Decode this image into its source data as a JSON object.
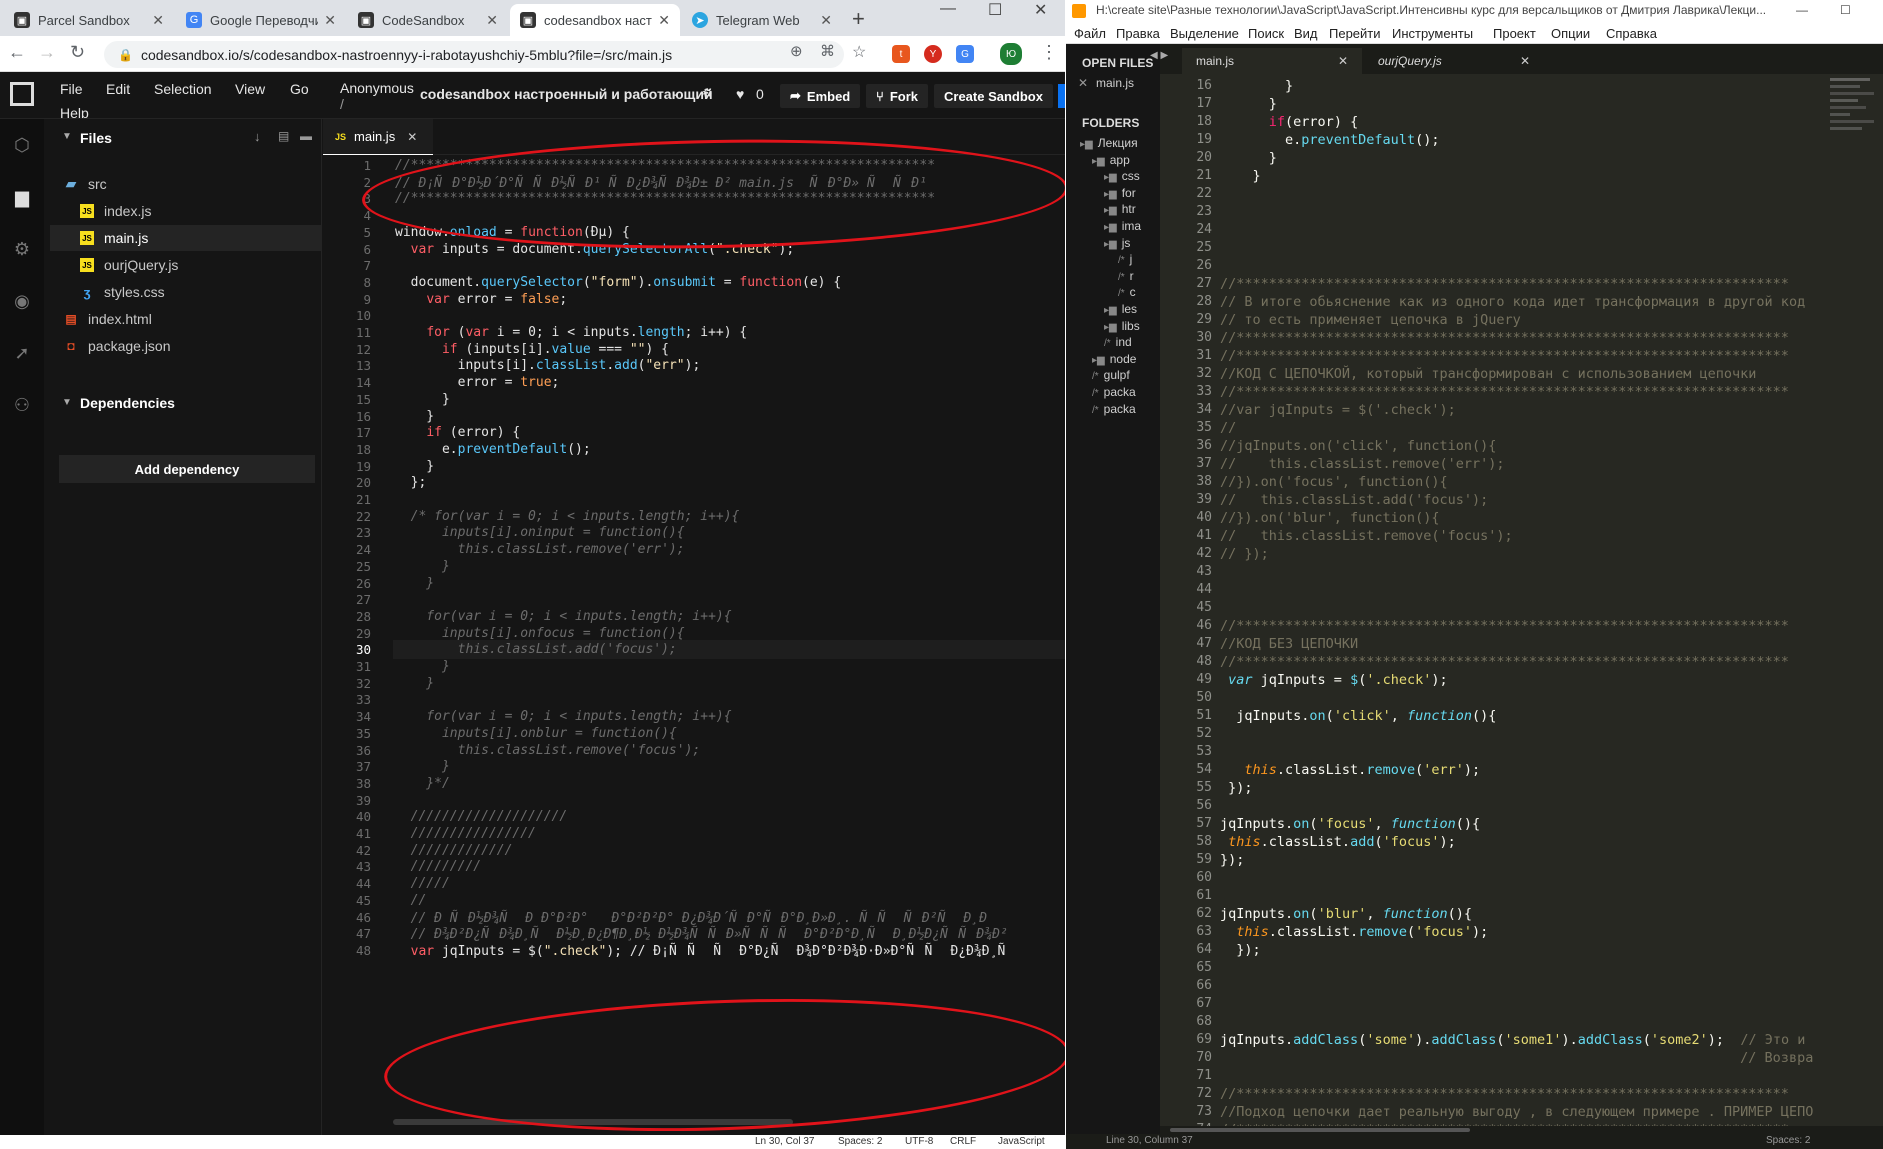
{
  "chrome": {
    "tabs": [
      {
        "title": "Parcel Sandbox",
        "icon": "codesandbox-icon"
      },
      {
        "title": "Google Переводчик",
        "icon": "google-translate-icon"
      },
      {
        "title": "CodeSandbox",
        "icon": "codesandbox-icon"
      },
      {
        "title": "codesandbox настр",
        "icon": "codesandbox-icon",
        "active": true
      },
      {
        "title": "Telegram Web",
        "icon": "telegram-icon"
      }
    ],
    "url": "codesandbox.io/s/codesandbox-nastroennyy-i-rabotayushchiy-5mblu?file=/src/main.js",
    "profile_initial": "Ю"
  },
  "csb": {
    "menu": [
      "File",
      "Edit",
      "Selection",
      "View",
      "Go",
      "Help"
    ],
    "owner": "Anonymous",
    "owner_sep": "/",
    "title": "codesandbox настроенный и работающий",
    "likes": "0",
    "embed": "Embed",
    "fork": "Fork",
    "create": "Create Sandbox",
    "files_title": "Files",
    "deps_title": "Dependencies",
    "add_dep": "Add dependency",
    "tree": [
      {
        "name": "src",
        "type": "folder"
      },
      {
        "name": "index.js",
        "type": "js"
      },
      {
        "name": "main.js",
        "type": "js",
        "selected": true
      },
      {
        "name": "ourjQuery.js",
        "type": "js"
      },
      {
        "name": "styles.css",
        "type": "css"
      },
      {
        "name": "index.html",
        "type": "html"
      },
      {
        "name": "package.json",
        "type": "json"
      }
    ],
    "editor_tab": "main.js",
    "editor_tab_prefix": "JS",
    "current_line": "30",
    "code": [
      "//*******************************************************************",
      "// Ð¡ÑÐ°Ð½Ð´Ð°ÑÑÐ½ÑÐ¹ ÑÐ¿Ð¾ÑÐ¾Ð± Ð² main.js  ÑÐ°Ð» Ñ ÑÐ¹",
      "//*******************************************************************",
      "",
      "window.onload = function(Ðµ) {",
      "  var inputs = document.querySelectorAll(\".check\");",
      "",
      "  document.querySelector(\"form\").onsubmit = function(e) {",
      "    var error = false;",
      "",
      "    for (var i = 0; i < inputs.length; i++) {",
      "      if (inputs[i].value === \"\") {",
      "        inputs[i].classList.add(\"err\");",
      "        error = true;",
      "      }",
      "    }",
      "    if (error) {",
      "      e.preventDefault();",
      "    }",
      "  };",
      "",
      "  /* for(var i = 0; i < inputs.length; i++){",
      "      inputs[i].oninput = function(){",
      "        this.classList.remove('err');",
      "      }",
      "    }",
      "",
      "    for(var i = 0; i < inputs.length; i++){",
      "      inputs[i].onfocus = function(){",
      "        this.classList.add('focus');",
      "      }",
      "    }",
      "",
      "    for(var i = 0; i < inputs.length; i++){",
      "      inputs[i].onblur = function(){",
      "        this.classList.remove('focus');",
      "      }",
      "    }*/",
      "",
      "  ////////////////////",
      "  ////////////////",
      "  /////////////",
      "  /////////",
      "  /////",
      "  //",
      "  // ÐÑÐ½Ð¾Ñ ÐÐ°Ð²Ð°   Ð°Ð²Ð²Ð° Ð¿Ð¾Ð´ÑÐ°ÑÐ°Ð¸Ð»Ð¸. ÑÑ ÑÐ²Ñ Ð¸Ð",
      "  // Ð¾Ð²Ð¿ÑÐ¾Ð¸Ñ Ð½Ð¸Ð¿Ð¶Ð¸Ð½ Ð½Ð¾ÑÑÐ»ÑÑÑ Ð°Ð²Ð°Ð¸Ñ Ð¸Ð½Ð¿ÑÑÐ¾Ð²",
      "  var jqInputs = $(\".check\"); // Ð¡ÑÑ Ñ Ð°Ð¿Ñ Ð¾Ð°Ð²Ð¾Ð·Ð»Ð°ÑÑ Ð¿Ð¾Ð¸Ñ"
    ],
    "status": {
      "position": "Ln 30, Col 37",
      "spaces": "Spaces: 2",
      "encoding": "UTF-8",
      "eol": "CRLF",
      "language": "JavaScript"
    }
  },
  "sublime": {
    "title": "H:\\create site\\Разные технологии\\JavaScript\\JavaScript.Интенсивны курс для версальщиков от Дмитрия Лаврика\\Лекци...",
    "menu": [
      "Файл",
      "Правка",
      "Выделение",
      "Поиск",
      "Вид",
      "Перейти",
      "Инструменты",
      "Проект",
      "Опции",
      "Справка"
    ],
    "open_files_title": "OPEN FILES",
    "folders_title": "FOLDERS",
    "open_files": [
      "main.js"
    ],
    "folders": [
      "Лекция",
      "app",
      "css",
      "for",
      "htr",
      "ima",
      "js",
      "j",
      "r",
      "c",
      "les",
      "libs",
      "ind",
      "node",
      "gulpf",
      "packa",
      "packa"
    ],
    "tabs": [
      "main.js",
      "ourjQuery.js"
    ],
    "first_line": 16,
    "code": [
      "        }",
      "      }",
      "      if(error) {",
      "        e.preventDefault();",
      "      }",
      "    }",
      "",
      "",
      "",
      "",
      "",
      "//********************************************************************",
      "// В итоге обьяснение как из одного кода идет трансформация в другой код",
      "// то есть применяет цепочка в jQuery",
      "//********************************************************************",
      "//********************************************************************",
      "//КОД С ЦЕПОЧКОЙ, который трансформирован с использованием цепочки",
      "//********************************************************************",
      "//var jqInputs = $('.check');",
      "//",
      "//jqInputs.on('click', function(){",
      "//    this.classList.remove('err');",
      "//}).on('focus', function(){",
      "//   this.classList.add('focus');",
      "//}).on('blur', function(){",
      "//   this.classList.remove('focus');",
      "// });",
      "",
      "",
      "",
      "//********************************************************************",
      "//КОД БЕЗ ЦЕПОЧКИ",
      "//********************************************************************",
      " var jqInputs = $('.check');",
      "",
      "  jqInputs.on('click', function(){",
      "",
      "",
      "   this.classList.remove('err');",
      " });",
      "",
      "jqInputs.on('focus', function(){",
      " this.classList.add('focus');",
      "});",
      "",
      "",
      "jqInputs.on('blur', function(){",
      "  this.classList.remove('focus');",
      "  });",
      "",
      "",
      "",
      "",
      "jqInputs.addClass('some').addClass('some1').addClass('some2');  // Это и ",
      "                                                                // Возвра",
      "",
      "//********************************************************************",
      "//Подход цепочки дает реальную выгоду , в следующем примере . ПРИМЕР ЦЕПО",
      "//********************************************************************"
    ],
    "status": "Line 30, Column 37",
    "status_right": "Spaces: 2"
  }
}
